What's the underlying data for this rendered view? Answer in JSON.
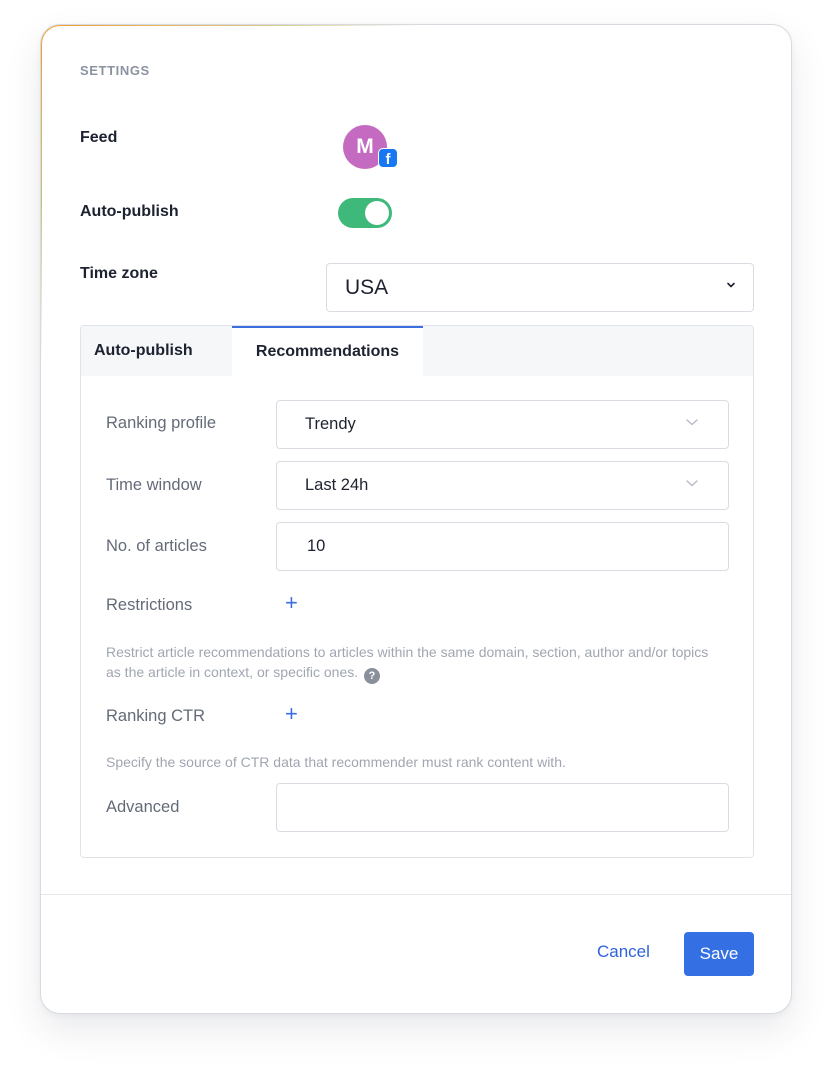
{
  "section_title": "SETTINGS",
  "feed": {
    "label": "Feed",
    "avatar_letter": "M",
    "avatar_color": "#c46bc1",
    "badge_icon": "facebook-icon",
    "badge_letter": "f"
  },
  "auto_publish": {
    "label": "Auto-publish",
    "enabled": true,
    "toggle_color": "#3fb97a"
  },
  "time_zone": {
    "label": "Time zone",
    "value": "USA"
  },
  "tabs": [
    {
      "label": "Auto-publish",
      "active": false
    },
    {
      "label": "Recommendations",
      "active": true
    }
  ],
  "recommendations": {
    "ranking_profile": {
      "label": "Ranking profile",
      "value": "Trendy"
    },
    "time_window": {
      "label": "Time window",
      "value": "Last 24h"
    },
    "articles": {
      "label": "No. of articles",
      "value": "10"
    },
    "restrictions": {
      "label": "Restrictions",
      "help": "Restrict article recommendations to articles within the same domain, section, author and/or topics as the article in context, or specific ones."
    },
    "ranking_ctr": {
      "label": "Ranking CTR",
      "help": "Specify the source of CTR data that recommender must rank content with."
    },
    "advanced": {
      "label": "Advanced",
      "value": ""
    }
  },
  "actions": {
    "cancel_label": "Cancel",
    "save_label": "Save",
    "accent_color": "#3470e4"
  }
}
